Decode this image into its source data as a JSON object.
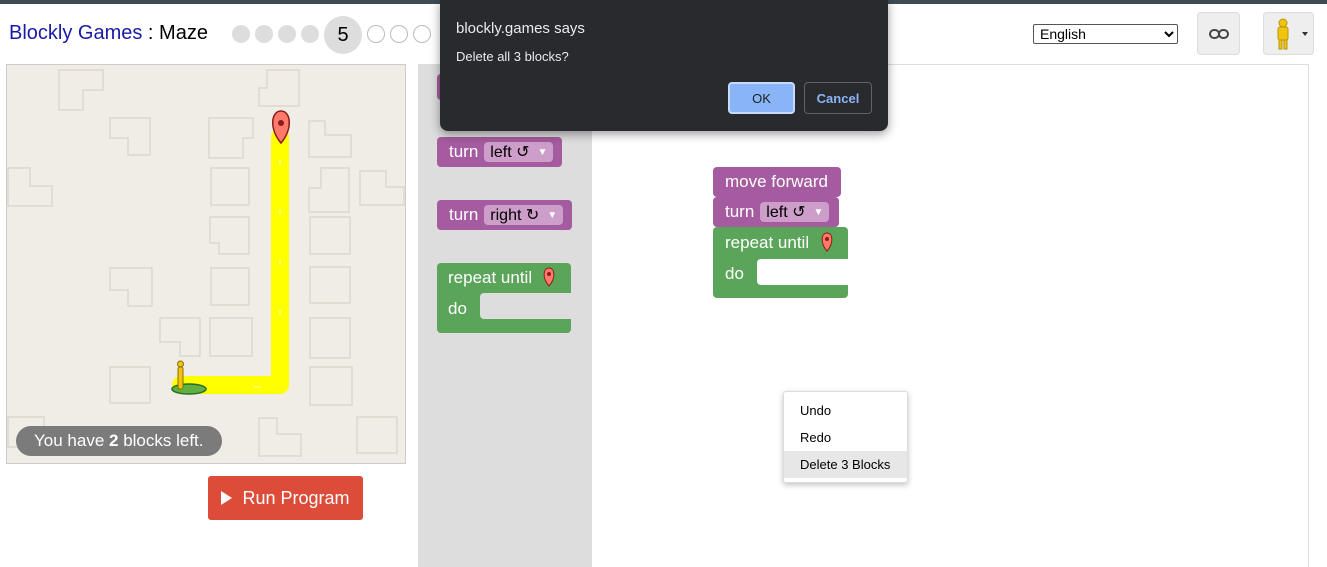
{
  "header": {
    "app_name": "Blockly Games",
    "separator": " : ",
    "game_name": "Maze",
    "current_level": "5",
    "language": "English",
    "language_options": [
      "English"
    ]
  },
  "levels": {
    "total": 10,
    "current": 5
  },
  "maze": {
    "capacity_prefix": "You have ",
    "capacity_count": "2",
    "capacity_suffix": " blocks left.",
    "run_label": "Run Program"
  },
  "toolbox": {
    "turn_left": {
      "keyword": "turn",
      "direction": "left ↺"
    },
    "turn_right": {
      "keyword": "turn",
      "direction": "right ↻"
    },
    "repeat": {
      "keyword": "repeat until",
      "do": "do"
    }
  },
  "workspace": {
    "move_forward": "move forward",
    "turn": {
      "keyword": "turn",
      "direction": "left ↺"
    },
    "repeat": {
      "keyword": "repeat until",
      "do": "do"
    }
  },
  "context_menu": {
    "items": [
      "Undo",
      "Redo",
      "Delete 3 Blocks"
    ],
    "highlighted": "Delete 3 Blocks"
  },
  "dialog": {
    "from": "blockly.games says",
    "message": "Delete all 3 blocks?",
    "ok": "OK",
    "cancel": "Cancel"
  },
  "colors": {
    "motion_block": "#a55b9f",
    "loop_block": "#5ba55b",
    "path": "#ffff00",
    "run_button": "#dd4b39",
    "link_color": "#1a1aa6"
  }
}
